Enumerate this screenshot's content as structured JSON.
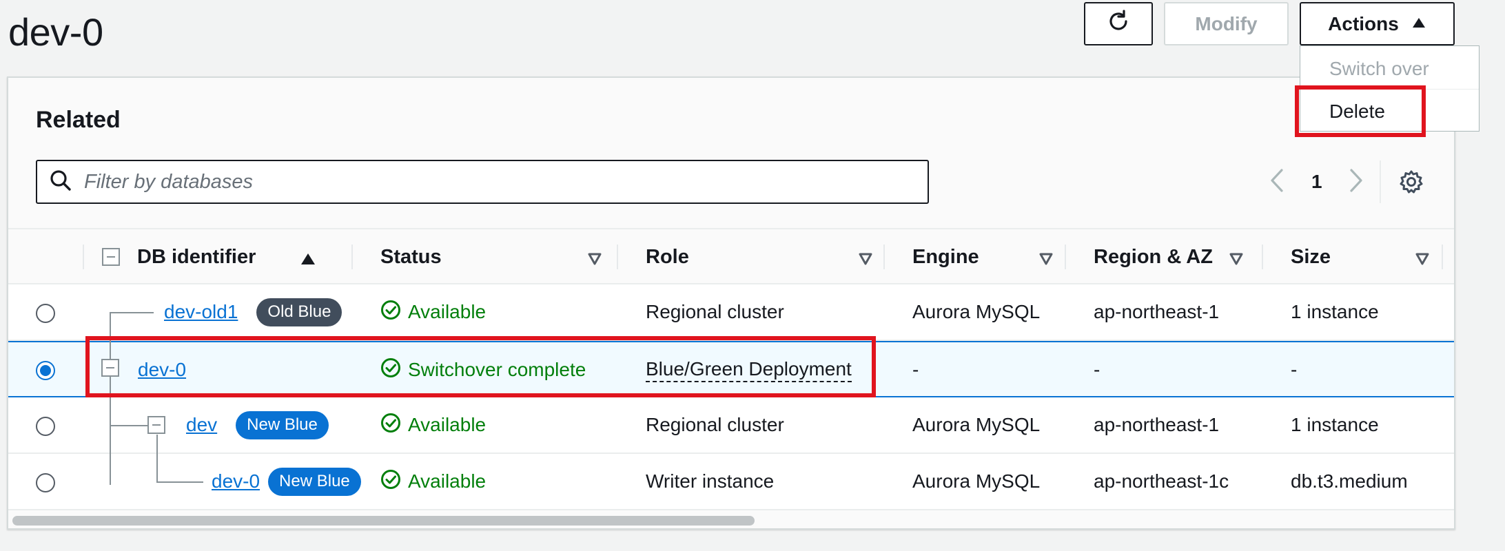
{
  "page": {
    "title": "dev-0"
  },
  "header": {
    "modify_label": "Modify",
    "actions_label": "Actions"
  },
  "actions_menu": {
    "items": [
      {
        "label": "Switch over",
        "disabled": true
      },
      {
        "label": "Delete",
        "disabled": false
      }
    ]
  },
  "panel": {
    "title": "Related",
    "search": {
      "placeholder": "Filter by databases",
      "value": ""
    },
    "pagination": {
      "current_page": "1"
    }
  },
  "table": {
    "columns": [
      "DB identifier",
      "Status",
      "Role",
      "Engine",
      "Region & AZ",
      "Size"
    ],
    "rows": [
      {
        "id": "dev-old1",
        "badge": "Old Blue",
        "status": "Available",
        "role": "Regional cluster",
        "engine": "Aurora MySQL",
        "region": "ap-northeast-1",
        "size": "1 instance",
        "selected": false
      },
      {
        "id": "dev-0",
        "badge": "",
        "status": "Switchover complete",
        "role": "Blue/Green Deployment",
        "engine": "-",
        "region": "-",
        "size": "-",
        "selected": true
      },
      {
        "id": "dev",
        "badge": "New Blue",
        "status": "Available",
        "role": "Regional cluster",
        "engine": "Aurora MySQL",
        "region": "ap-northeast-1",
        "size": "1 instance",
        "selected": false
      },
      {
        "id": "dev-0",
        "badge": "New Blue",
        "status": "Available",
        "role": "Writer instance",
        "engine": "Aurora MySQL",
        "region": "ap-northeast-1c",
        "size": "db.t3.medium",
        "selected": false
      }
    ]
  },
  "colors": {
    "link": "#0972d3",
    "status_ok": "#037f0c",
    "highlight": "#e0141e",
    "badge_old": "#414d5c",
    "badge_new": "#0972d3"
  }
}
